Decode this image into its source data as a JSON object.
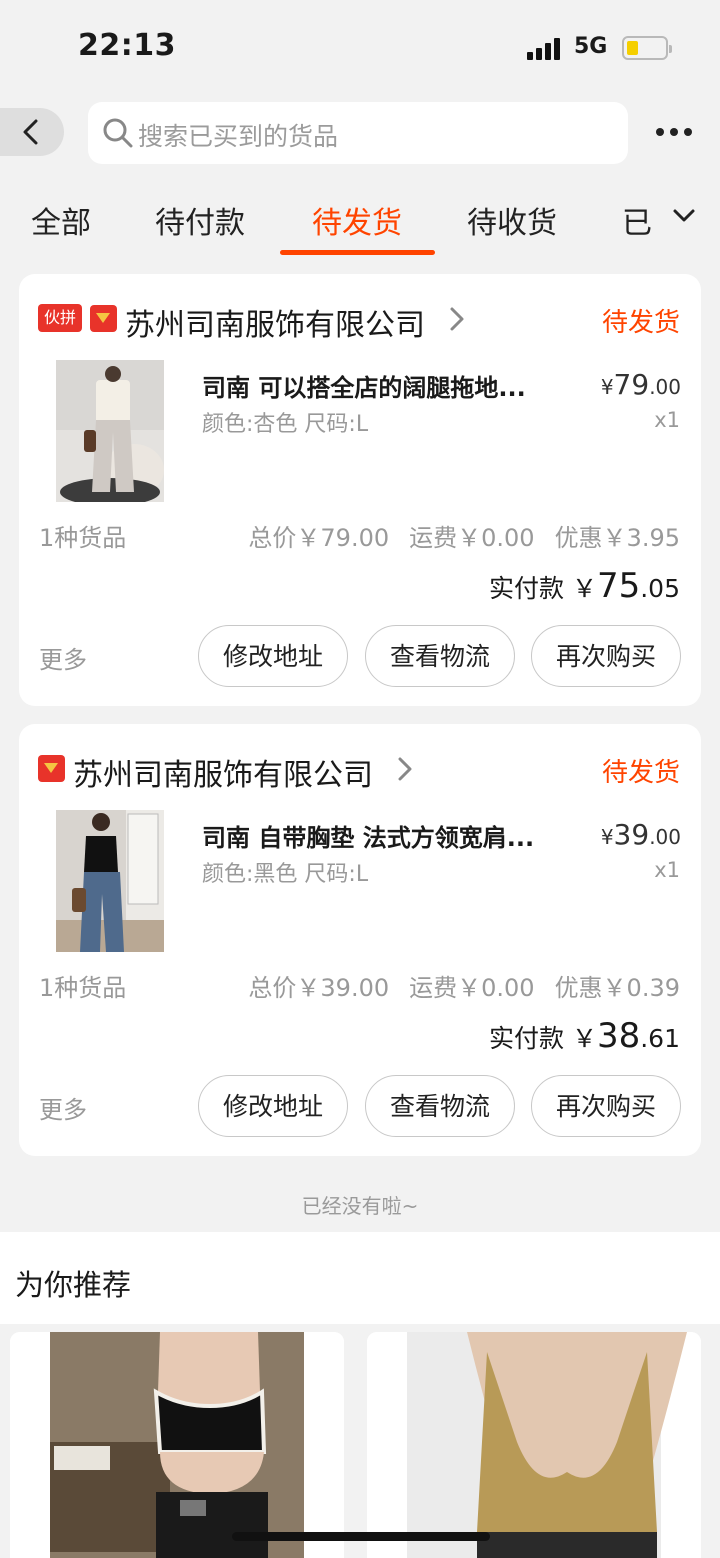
{
  "status_bar": {
    "time": "22:13",
    "network": "5G",
    "battery_level": 0.25
  },
  "search": {
    "placeholder": "搜索已买到的货品"
  },
  "tabs": [
    {
      "label": "全部",
      "active": false
    },
    {
      "label": "待付款",
      "active": false
    },
    {
      "label": "待发货",
      "active": true
    },
    {
      "label": "待收货",
      "active": false
    },
    {
      "label": "已",
      "active": false
    }
  ],
  "orders": [
    {
      "group_badge": "伙拼",
      "shop": "苏州司南服饰有限公司",
      "status": "待发货",
      "product": {
        "title": "司南 可以搭全店的阔腿拖地...",
        "spec": "颜色:杏色 尺码:L",
        "price_yen": "¥",
        "price_int": "79",
        "price_dec": ".00",
        "qty": "x1"
      },
      "item_count": "1种货品",
      "total": "总价￥79.00",
      "shipping": "运费￥0.00",
      "discount": "优惠￥3.95",
      "paid_label": "实付款",
      "paid_yen": "￥",
      "paid_int": "75",
      "paid_dec": ".05",
      "more": "更多",
      "buttons": [
        "修改地址",
        "查看物流",
        "再次购买"
      ]
    },
    {
      "group_badge": "",
      "shop": "苏州司南服饰有限公司",
      "status": "待发货",
      "product": {
        "title": "司南 自带胸垫 法式方领宽肩...",
        "spec": "颜色:黑色 尺码:L",
        "price_yen": "¥",
        "price_int": "39",
        "price_dec": ".00",
        "qty": "x1"
      },
      "item_count": "1种货品",
      "total": "总价￥39.00",
      "shipping": "运费￥0.00",
      "discount": "优惠￥0.39",
      "paid_label": "实付款",
      "paid_yen": "￥",
      "paid_int": "38",
      "paid_dec": ".61",
      "more": "更多",
      "buttons": [
        "修改地址",
        "查看物流",
        "再次购买"
      ]
    }
  ],
  "end_text": "已经没有啦~",
  "recommend": {
    "title": "为你推荐"
  },
  "colors": {
    "accent": "#ff4400",
    "badge": "#e8332a",
    "background": "#f2f2f2"
  },
  "icons": [
    "back-arrow-icon",
    "search-icon",
    "more-dots-icon",
    "chevron-down-icon",
    "chevron-right-icon",
    "shop-logo-icon"
  ]
}
